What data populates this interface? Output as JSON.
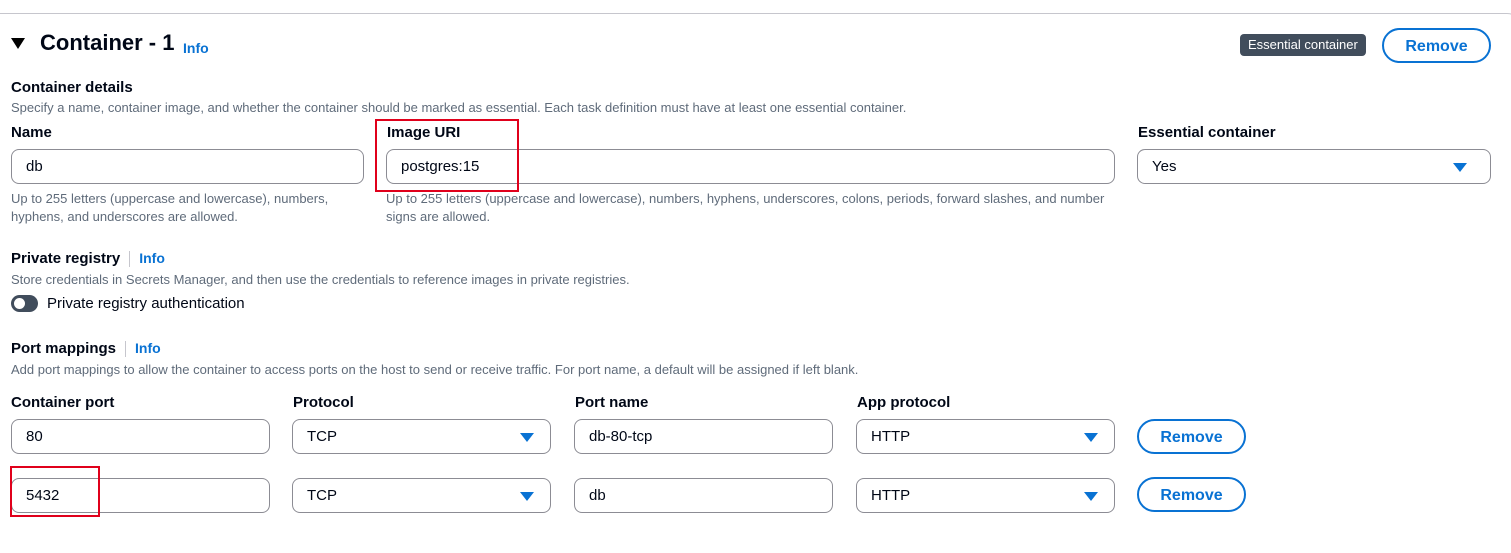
{
  "header": {
    "title": "Container - 1",
    "info": "Info",
    "badge": "Essential container",
    "remove": "Remove"
  },
  "details": {
    "heading": "Container details",
    "description": "Specify a name, container image, and whether the container should be marked as essential. Each task definition must have at least one essential container.",
    "name_label": "Name",
    "name_value": "db",
    "name_hint": "Up to 255 letters (uppercase and lowercase), numbers, hyphens, and underscores are allowed.",
    "image_label": "Image URI",
    "image_value": "postgres:15",
    "image_hint": "Up to 255 letters (uppercase and lowercase), numbers, hyphens, underscores, colons, periods, forward slashes, and number signs are allowed.",
    "essential_label": "Essential container",
    "essential_value": "Yes"
  },
  "private_registry": {
    "heading": "Private registry",
    "info": "Info",
    "description": "Store credentials in Secrets Manager, and then use the credentials to reference images in private registries.",
    "toggle_label": "Private registry authentication"
  },
  "port_mappings": {
    "heading": "Port mappings",
    "info": "Info",
    "description": "Add port mappings to allow the container to access ports on the host to send or receive traffic. For port name, a default will be assigned if left blank.",
    "col_port": "Container port",
    "col_protocol": "Protocol",
    "col_name": "Port name",
    "col_app": "App protocol",
    "rows": [
      {
        "port": "80",
        "protocol": "TCP",
        "name": "db-80-tcp",
        "app": "HTTP",
        "remove": "Remove"
      },
      {
        "port": "5432",
        "protocol": "TCP",
        "name": "db",
        "app": "HTTP",
        "remove": "Remove"
      }
    ]
  },
  "colors": {
    "accent": "#0972d3",
    "highlight": "#e0001b",
    "badge": "#414d5c"
  }
}
